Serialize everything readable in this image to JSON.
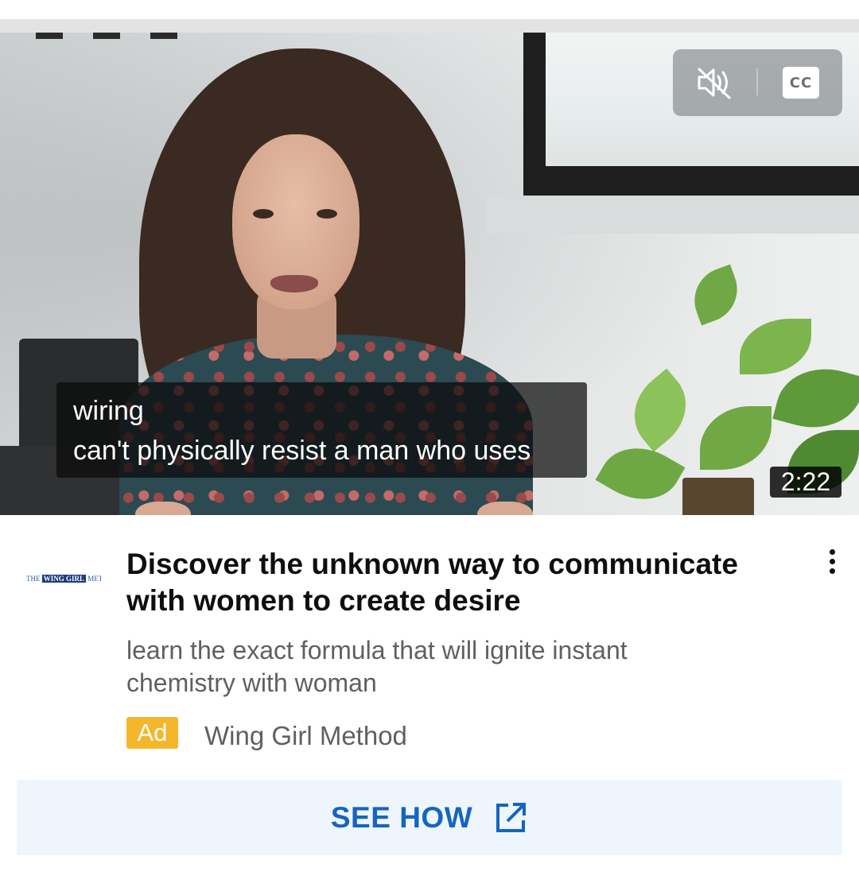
{
  "video": {
    "captions": {
      "line1": "wiring",
      "line2": "can't physically resist a man who uses"
    },
    "duration": "2:22",
    "controls": {
      "mute_icon": "volume-muted-icon",
      "cc_label": "CC"
    }
  },
  "ad": {
    "channel_logo_text": [
      "THE",
      "WING GIRL",
      "METHOD"
    ],
    "title": "Discover the unknown way to communicate with women to create desire",
    "description": "learn the exact formula that will ignite instant chemistry with woman",
    "badge": "Ad",
    "advertiser": "Wing Girl Method",
    "more_icon": "more-vertical-icon"
  },
  "cta": {
    "label": "SEE HOW",
    "icon": "open-external-icon"
  },
  "colors": {
    "cta_text": "#1565c0",
    "cta_bg": "#eef5fd",
    "ad_badge": "#f4b62b",
    "title": "#0f0f0f",
    "secondary_text": "#606060"
  }
}
